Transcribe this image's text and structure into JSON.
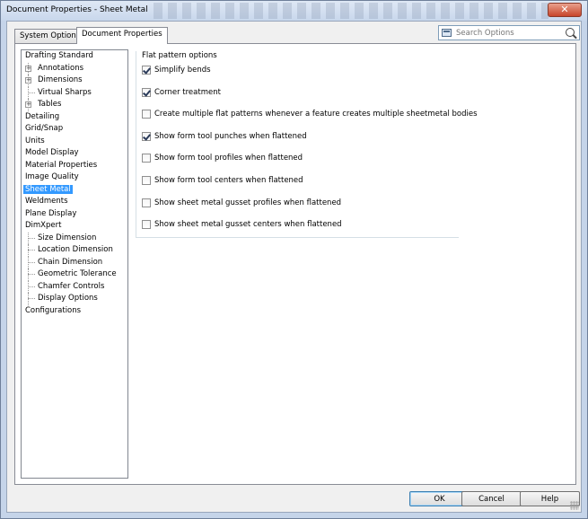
{
  "window": {
    "title": "Document Properties - Sheet Metal",
    "close_glyph": "✕"
  },
  "tabs": [
    {
      "label": "System Options",
      "active": false
    },
    {
      "label": "Document Properties",
      "active": true
    }
  ],
  "search": {
    "placeholder": "Search Options",
    "icon": "search-icon"
  },
  "tree": [
    {
      "label": "Drafting Standard",
      "level": 0,
      "expander": false
    },
    {
      "label": "Annotations",
      "level": 1,
      "expander": true
    },
    {
      "label": "Dimensions",
      "level": 1,
      "expander": true
    },
    {
      "label": "Virtual Sharps",
      "level": 1,
      "expander": false
    },
    {
      "label": "Tables",
      "level": 1,
      "expander": true
    },
    {
      "label": "Detailing",
      "level": 0,
      "expander": false
    },
    {
      "label": "Grid/Snap",
      "level": 0,
      "expander": false
    },
    {
      "label": "Units",
      "level": 0,
      "expander": false
    },
    {
      "label": "Model Display",
      "level": 0,
      "expander": false
    },
    {
      "label": "Material Properties",
      "level": 0,
      "expander": false
    },
    {
      "label": "Image Quality",
      "level": 0,
      "expander": false
    },
    {
      "label": "Sheet Metal",
      "level": 0,
      "expander": false,
      "selected": true
    },
    {
      "label": "Weldments",
      "level": 0,
      "expander": false
    },
    {
      "label": "Plane Display",
      "level": 0,
      "expander": false
    },
    {
      "label": "DimXpert",
      "level": 0,
      "expander": false
    },
    {
      "label": "Size Dimension",
      "level": 1,
      "expander": false
    },
    {
      "label": "Location Dimension",
      "level": 1,
      "expander": false
    },
    {
      "label": "Chain Dimension",
      "level": 1,
      "expander": false
    },
    {
      "label": "Geometric Tolerance",
      "level": 1,
      "expander": false
    },
    {
      "label": "Chamfer Controls",
      "level": 1,
      "expander": false
    },
    {
      "label": "Display Options",
      "level": 1,
      "expander": false
    },
    {
      "label": "Configurations",
      "level": 0,
      "expander": false
    }
  ],
  "flat_pattern": {
    "title": "Flat pattern options",
    "options": [
      {
        "label": "Simplify bends",
        "checked": true
      },
      {
        "label": "Corner treatment",
        "checked": true
      },
      {
        "label": "Create multiple flat patterns whenever a feature creates multiple sheetmetal bodies",
        "checked": false
      },
      {
        "label": "Show form tool punches when flattened",
        "checked": true
      },
      {
        "label": "Show form tool profiles when flattened",
        "checked": false
      },
      {
        "label": "Show form tool centers when flattened",
        "checked": false
      },
      {
        "label": "Show sheet metal gusset profiles when flattened",
        "checked": false
      },
      {
        "label": "Show sheet metal gusset centers when flattened",
        "checked": false
      }
    ]
  },
  "buttons": {
    "ok": "OK",
    "cancel": "Cancel",
    "help": "Help"
  },
  "colors": {
    "selection": "#3399ff",
    "titlebar": "#c8d7ec"
  }
}
